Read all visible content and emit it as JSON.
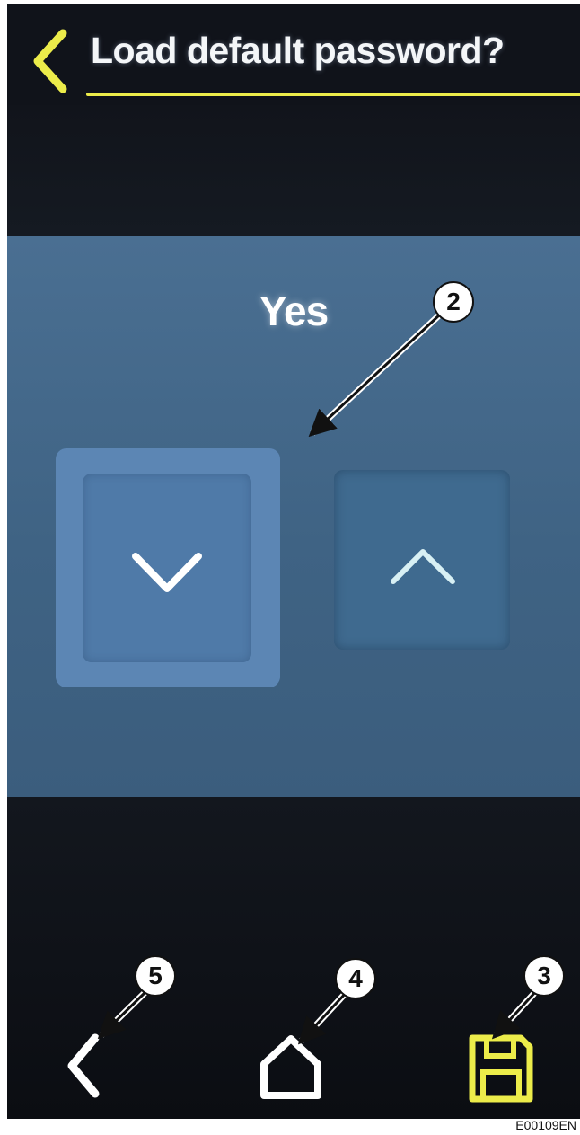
{
  "header": {
    "title": "Load default password?",
    "back_icon": "chevron-left-icon",
    "accent_color": "#ecec4a"
  },
  "panel": {
    "value": "Yes",
    "decrease_icon": "chevron-down-icon",
    "increase_icon": "chevron-up-icon"
  },
  "nav": {
    "back_icon": "chevron-left-icon",
    "home_icon": "home-icon",
    "save_icon": "floppy-disk-icon",
    "save_color": "#ecec4a"
  },
  "callouts": [
    "2",
    "5",
    "4",
    "3"
  ],
  "figure_code": "E00109EN"
}
